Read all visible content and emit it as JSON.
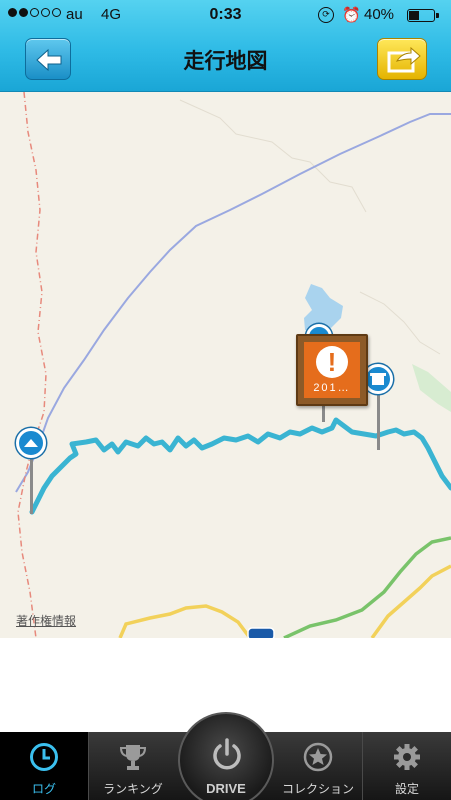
{
  "status": {
    "signal_total": 5,
    "signal_filled": 2,
    "carrier": "au",
    "network": "4G",
    "time": "0:33",
    "lock_icon": "orientation-lock-icon",
    "alarm_icon": "alarm-icon",
    "battery": "40%",
    "battery_level": 0.4
  },
  "nav": {
    "title": "走行地図",
    "back_icon": "arrow-left-icon",
    "share_icon": "share-icon"
  },
  "map": {
    "copyright": "著作権情報",
    "photo_label": "201…",
    "photo_badge": "!",
    "colors": {
      "route": "#3ab4d2",
      "highway": "#9aa8e0",
      "boundary": "#e7897c",
      "national_road": "#f2d15a",
      "green_road": "#79c36a",
      "lake": "#a9d3ee",
      "land": "#f4f1e8"
    }
  },
  "tabs": [
    {
      "label": "ログ",
      "icon": "clock-icon",
      "active": true
    },
    {
      "label": "ランキング",
      "icon": "trophy-icon",
      "active": false
    },
    {
      "label": "DRIVE",
      "icon": "power-icon",
      "active": false
    },
    {
      "label": "コレクション",
      "icon": "star-circle-icon",
      "active": false
    },
    {
      "label": "設定",
      "icon": "gear-icon",
      "active": false
    }
  ]
}
